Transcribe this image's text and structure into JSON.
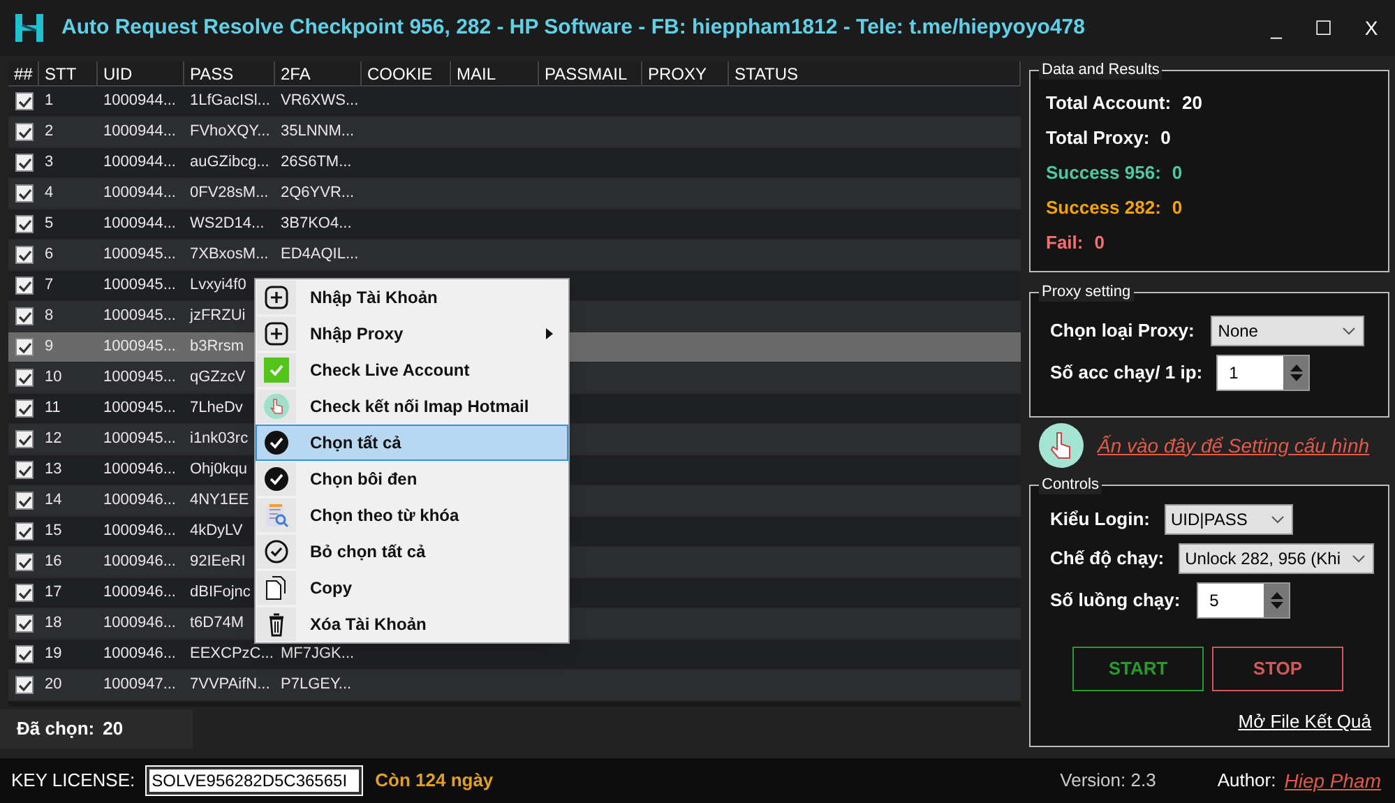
{
  "window": {
    "title": "Auto Request Resolve Checkpoint 956, 282 - HP Software - FB: hieppham1812 - Tele: t.me/hiepyoyo478",
    "buttons": [
      "_",
      "☐",
      "X"
    ]
  },
  "table": {
    "columns": [
      "##",
      "STT",
      "UID",
      "PASS",
      "2FA",
      "COOKIE",
      "MAIL",
      "PASSMAIL",
      "PROXY",
      "STATUS"
    ],
    "rows": [
      {
        "checked": true,
        "selected": false,
        "stt": "1",
        "uid": "1000944...",
        "pass": "1LfGacISl...",
        "twofa": "VR6XWS..."
      },
      {
        "checked": true,
        "selected": false,
        "stt": "2",
        "uid": "1000944...",
        "pass": "FVhoXQY...",
        "twofa": "35LNNM..."
      },
      {
        "checked": true,
        "selected": false,
        "stt": "3",
        "uid": "1000944...",
        "pass": "auGZibcg...",
        "twofa": "26S6TM..."
      },
      {
        "checked": true,
        "selected": false,
        "stt": "4",
        "uid": "1000944...",
        "pass": "0FV28sM...",
        "twofa": "2Q6YVR..."
      },
      {
        "checked": true,
        "selected": false,
        "stt": "5",
        "uid": "1000944...",
        "pass": "WS2D14...",
        "twofa": "3B7KO4..."
      },
      {
        "checked": true,
        "selected": false,
        "stt": "6",
        "uid": "1000945...",
        "pass": "7XBxosM...",
        "twofa": "ED4AQIL..."
      },
      {
        "checked": true,
        "selected": false,
        "stt": "7",
        "uid": "1000945...",
        "pass": "Lvxyi4f0"
      },
      {
        "checked": true,
        "selected": false,
        "stt": "8",
        "uid": "1000945...",
        "pass": "jzFRZUi"
      },
      {
        "checked": true,
        "selected": true,
        "stt": "9",
        "uid": "1000945...",
        "pass": "b3Rrsm"
      },
      {
        "checked": true,
        "selected": false,
        "stt": "10",
        "uid": "1000945...",
        "pass": "qGZzcV"
      },
      {
        "checked": true,
        "selected": false,
        "stt": "11",
        "uid": "1000945...",
        "pass": "7LheDv"
      },
      {
        "checked": true,
        "selected": false,
        "stt": "12",
        "uid": "1000945...",
        "pass": "i1nk03rc"
      },
      {
        "checked": true,
        "selected": false,
        "stt": "13",
        "uid": "1000946...",
        "pass": "Ohj0kqu"
      },
      {
        "checked": true,
        "selected": false,
        "stt": "14",
        "uid": "1000946...",
        "pass": "4NY1EE"
      },
      {
        "checked": true,
        "selected": false,
        "stt": "15",
        "uid": "1000946...",
        "pass": "4kDyLV"
      },
      {
        "checked": true,
        "selected": false,
        "stt": "16",
        "uid": "1000946...",
        "pass": "92IEeRI"
      },
      {
        "checked": true,
        "selected": false,
        "stt": "17",
        "uid": "1000946...",
        "pass": "dBIFojnc"
      },
      {
        "checked": true,
        "selected": false,
        "stt": "18",
        "uid": "1000946...",
        "pass": "t6D74M"
      },
      {
        "checked": true,
        "selected": false,
        "stt": "19",
        "uid": "1000946...",
        "pass": "EEXCPzC...",
        "twofa": "MF7JGK..."
      },
      {
        "checked": true,
        "selected": false,
        "stt": "20",
        "uid": "1000947...",
        "pass": "7VVPAifN...",
        "twofa": "P7LGEY..."
      }
    ]
  },
  "selected_count": {
    "label": "Đã chọn:",
    "value": "20"
  },
  "context_menu": [
    {
      "label": "Nhập Tài Khoản",
      "selected": false,
      "has_submenu": false
    },
    {
      "label": "Nhập Proxy",
      "selected": false,
      "has_submenu": true
    },
    {
      "label": "Check Live Account",
      "selected": false,
      "has_submenu": false
    },
    {
      "label": "Check kết nối Imap Hotmail",
      "selected": false,
      "has_submenu": false
    },
    {
      "label": "Chọn tất cả",
      "selected": true,
      "has_submenu": false
    },
    {
      "label": "Chọn bôi đen",
      "selected": false,
      "has_submenu": false
    },
    {
      "label": "Chọn theo từ khóa",
      "selected": false,
      "has_submenu": false
    },
    {
      "label": "Bỏ chọn tất cả",
      "selected": false,
      "has_submenu": false
    },
    {
      "label": "Copy",
      "selected": false,
      "has_submenu": false
    },
    {
      "label": "Xóa Tài Khoản",
      "selected": false,
      "has_submenu": false
    }
  ],
  "results": {
    "title": "Data and Results",
    "stats": [
      {
        "label": "Total Account:",
        "value": "20",
        "color": "#ffffff"
      },
      {
        "label": "Total Proxy:",
        "value": "0",
        "color": "#ffffff"
      },
      {
        "label": "Success 956:",
        "value": "0",
        "color": "#4ec9a0"
      },
      {
        "label": "Success 282:",
        "value": "0",
        "color": "#f5a300"
      },
      {
        "label": "Fail:",
        "value": "0",
        "color": "#f07070"
      }
    ]
  },
  "proxy_setting": {
    "title": "Proxy setting",
    "type_label": "Chọn loại Proxy:",
    "type_value": "None",
    "per_ip_label": "Số acc chạy/ 1 ip:",
    "per_ip_value": "1"
  },
  "setting_link": "Ấn vào đây để Setting cấu hình",
  "controls": {
    "title": "Controls",
    "login_label": "Kiểu Login:",
    "login_value": "UID|PASS",
    "mode_label": "Chế độ chạy:",
    "mode_value": "Unlock 282, 956 (Khi",
    "threads_label": "Số luồng chạy:",
    "threads_value": "5",
    "start": "START",
    "stop": "STOP",
    "open_file": "Mở File Kết Quả"
  },
  "status_bar": {
    "license_label": "KEY LICENSE:",
    "license_value": "SOLVE956282D5C36565I",
    "days_left": "Còn 124 ngày",
    "version": "Version: 2.3",
    "author_label": "Author:",
    "author": "Hiep Pham"
  }
}
